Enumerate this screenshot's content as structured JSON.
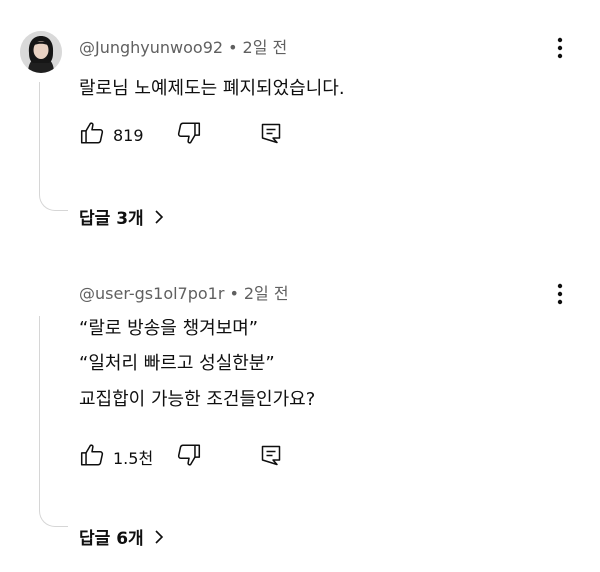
{
  "comments": [
    {
      "author": "@Junghyunwoo92",
      "separator": "•",
      "time": "2일 전",
      "lines": [
        "랄로님 노예제도는 폐지되었습니다."
      ],
      "likes": "819",
      "replies_label": "답글 3개"
    },
    {
      "author": "@user-gs1ol7po1r",
      "separator": "•",
      "time": "2일 전",
      "lines": [
        "“랄로 방송을 챙겨보며”",
        "“일처리 빠르고 성실한분”",
        "교집합이 가능한 조건들인가요?"
      ],
      "likes": "1.5천",
      "replies_label": "답글 6개"
    }
  ],
  "icons": {
    "like": "thumb-up-icon",
    "dislike": "thumb-down-icon",
    "reply": "comment-reply-icon",
    "more": "more-vert-icon",
    "expand": "chevron-right-icon"
  }
}
